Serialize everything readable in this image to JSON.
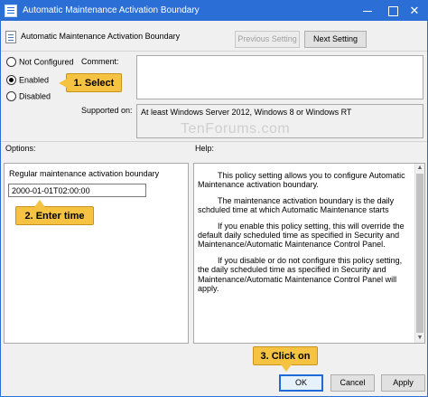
{
  "window": {
    "title": "Automatic Maintenance Activation Boundary",
    "close_glyph": "✕"
  },
  "header": {
    "title": "Automatic Maintenance Activation Boundary",
    "previous_label": "Previous Setting",
    "next_label": "Next Setting"
  },
  "state": {
    "options": [
      "Not Configured",
      "Enabled",
      "Disabled"
    ],
    "selected": "Enabled"
  },
  "comment": {
    "label": "Comment:",
    "value": ""
  },
  "supported": {
    "label": "Supported on:",
    "value": "At least Windows Server 2012, Windows 8 or Windows RT"
  },
  "watermark": "TenForums.com",
  "options_pane": {
    "label": "Options:",
    "field_label": "Regular maintenance activation boundary",
    "field_value": "2000-01-01T02:00:00"
  },
  "help_pane": {
    "label": "Help:",
    "paragraphs": [
      "This policy setting allows you to configure Automatic Maintenance activation boundary.",
      "The maintenance activation boundary is the daily schduled time at which Automatic Maintenance starts",
      "If you enable this policy setting, this will override the default daily scheduled time as specified in Security and Maintenance/Automatic Maintenance Control Panel.",
      "If you disable or do not configure this policy setting, the daily scheduled time as specified in Security and Maintenance/Automatic Maintenance Control Panel will apply."
    ]
  },
  "footer": {
    "ok_label": "OK",
    "cancel_label": "Cancel",
    "apply_label": "Apply"
  },
  "callouts": {
    "select": "1. Select",
    "enter_time": "2. Enter time",
    "click_on": "3. Click on"
  },
  "colors": {
    "titlebar": "#2b6fd6",
    "callout": "#f5c242",
    "dialog_bg": "#f0f0f0"
  }
}
